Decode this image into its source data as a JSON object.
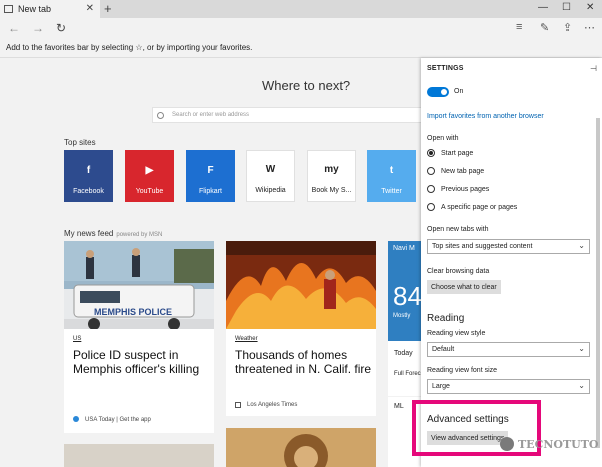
{
  "tab": {
    "title": "New tab"
  },
  "favorites_bar": {
    "text": "Add to the favorites bar by selecting ☆, or by importing your favorites."
  },
  "main": {
    "heading": "Where to next?",
    "search_placeholder": "Search or enter web address",
    "top_sites_label": "Top sites",
    "top_sites": [
      {
        "label": "Facebook",
        "bg": "#2d4b8e",
        "fg": "#ffffff",
        "glyph": "f"
      },
      {
        "label": "YouTube",
        "bg": "#d8262d",
        "fg": "#ffffff",
        "glyph": "▶"
      },
      {
        "label": "Flipkart",
        "bg": "#1d6fd1",
        "fg": "#ffffff",
        "glyph": "F"
      },
      {
        "label": "Wikipedia",
        "bg": "#ffffff",
        "fg": "#222222",
        "glyph": "W"
      },
      {
        "label": "Book My S...",
        "bg": "#ffffff",
        "fg": "#222222",
        "glyph": "my"
      },
      {
        "label": "Twitter",
        "bg": "#55acee",
        "fg": "#ffffff",
        "glyph": "t"
      }
    ],
    "news_label": "My news feed",
    "news_powered": "powered by MSN",
    "cards": [
      {
        "category": "US",
        "headline": "Police ID suspect in Memphis officer's killing",
        "source": "USA Today | Get the app"
      },
      {
        "category": "Weather",
        "headline": "Thousands of homes threatened in N. Calif. fire",
        "source": "Los Angeles Times"
      }
    ],
    "side_card": {
      "line1": "Navi M",
      "temp": "84",
      "line3": "Mostly",
      "line4": "Today",
      "line5": "Full Forec",
      "line6": "ML"
    }
  },
  "settings": {
    "title": "SETTINGS",
    "toggle_label": "On",
    "import_link": "Import favorites from another browser",
    "open_with_label": "Open with",
    "open_with_options": [
      "Start page",
      "New tab page",
      "Previous pages",
      "A specific page or pages"
    ],
    "open_new_tabs_label": "Open new tabs with",
    "open_new_tabs_value": "Top sites and suggested content",
    "clear_label": "Clear browsing data",
    "clear_button": "Choose what to clear",
    "reading_heading": "Reading",
    "reading_style_label": "Reading view style",
    "reading_style_value": "Default",
    "reading_font_label": "Reading view font size",
    "reading_font_value": "Large",
    "advanced_heading": "Advanced settings",
    "advanced_button": "View advanced settings"
  },
  "watermark": {
    "text": "TECNOTUTO"
  },
  "colors": {
    "accent": "#0078d7",
    "highlight": "#e5087a"
  }
}
